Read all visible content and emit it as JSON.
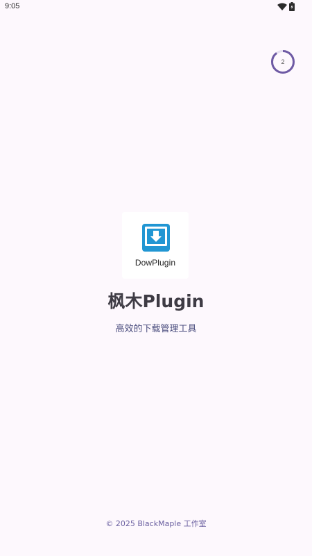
{
  "status_bar": {
    "time": "9:05",
    "icons": [
      "wifi-icon",
      "battery-icon"
    ]
  },
  "skip_countdown": {
    "value": "2",
    "progress_fraction": 0.9,
    "ring_color": "#6e5aa4",
    "track_color": "#e6e0f0"
  },
  "logo": {
    "icon": "download-tray-icon",
    "caption": "DowPlugin",
    "icon_color": "#2196d3"
  },
  "app": {
    "title": "枫木Plugin",
    "subtitle": "高效的下载管理工具"
  },
  "footer": {
    "copyright": "© 2025 BlackMaple 工作室"
  },
  "colors": {
    "background": "#fdf8fd",
    "title": "#3e3b44",
    "subtitle": "#4a4d7e",
    "footer": "#6a5fa0"
  }
}
